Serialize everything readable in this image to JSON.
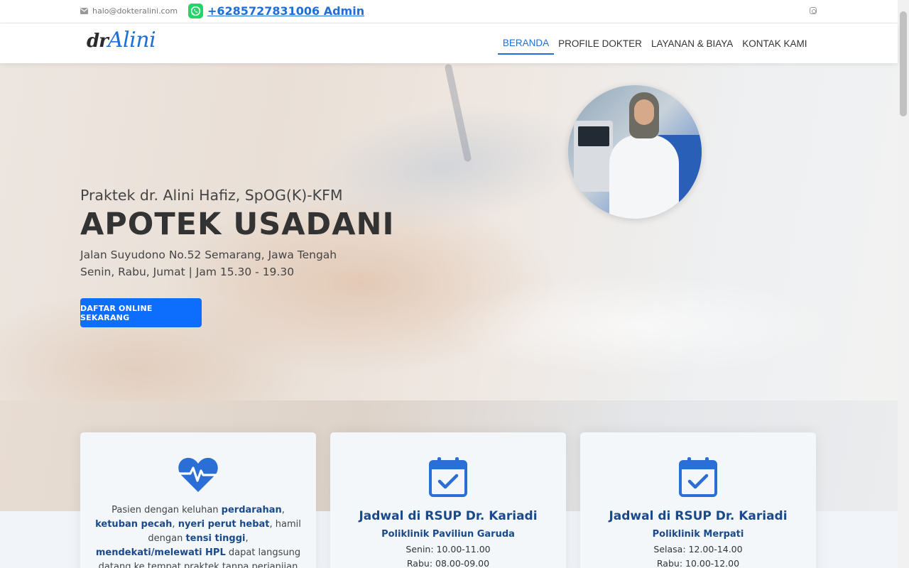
{
  "topbar": {
    "email": "halo@dokteralini.com",
    "whatsapp": "+6285727831006 Admin"
  },
  "nav": {
    "logo_dr": "dr",
    "logo_name": "Alini",
    "items": [
      {
        "label": "BERANDA",
        "active": true
      },
      {
        "label": "PROFILE DOKTER",
        "active": false
      },
      {
        "label": "LAYANAN & BIAYA",
        "active": false
      },
      {
        "label": "KONTAK KAMI",
        "active": false
      }
    ]
  },
  "hero": {
    "subtitle": "Praktek dr. Alini Hafiz, SpOG(K)-KFM",
    "title": "APOTEK USADANI",
    "address": "Jalan Suyudono No.52 Semarang, Jawa Tengah",
    "schedule": "Senin, Rabu, Jumat | Jam 15.30 - 19.30",
    "cta": "DAFTAR ONLINE SEKARANG"
  },
  "cards": [
    {
      "icon": "heartbeat-icon",
      "text_parts": [
        {
          "t": "Pasien dengan keluhan ",
          "b": false
        },
        {
          "t": "perdarahan",
          "b": true
        },
        {
          "t": ", ",
          "b": false
        },
        {
          "t": "ketuban pecah",
          "b": true
        },
        {
          "t": ", ",
          "b": false
        },
        {
          "t": "nyeri perut hebat",
          "b": true
        },
        {
          "t": ", hamil dengan ",
          "b": false
        },
        {
          "t": "tensi tinggi",
          "b": true
        },
        {
          "t": ", ",
          "b": false
        },
        {
          "t": "mendekati/melewati HPL",
          "b": true
        },
        {
          "t": " dapat langsung datang ke tempat praktek tanpa perjanjian",
          "b": false
        }
      ]
    },
    {
      "icon": "calendar-check-icon",
      "title": "Jadwal di RSUP Dr. Kariadi",
      "subtitle": "Poliklinik Paviliun Garuda",
      "line1": "Senin: 10.00-11.00",
      "line2": "Rabu: 08.00-09.00"
    },
    {
      "icon": "calendar-check-icon",
      "title": "Jadwal di RSUP Dr. Kariadi",
      "subtitle": "Poliklinik Merpati",
      "line1": "Selasa: 12.00-14.00",
      "line2": "Rabu: 10.00-12.00"
    }
  ],
  "colors": {
    "accent": "#0d6efd",
    "link": "#1e6fd9",
    "heading": "#1a4a8a",
    "whatsapp": "#25d366"
  }
}
